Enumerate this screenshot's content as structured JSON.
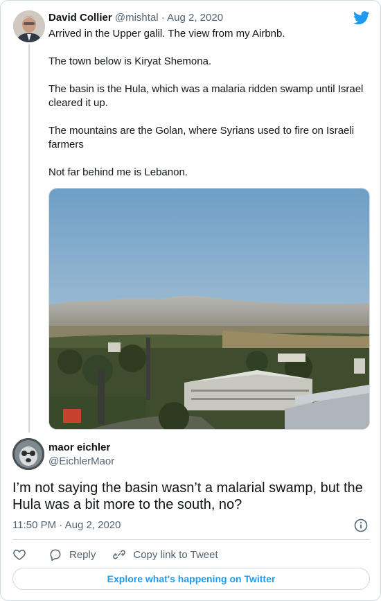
{
  "parent_tweet": {
    "author_name": "David Collier",
    "author_handle": "@mishtal",
    "date": "Aug 2, 2020",
    "separator": "·",
    "paragraphs": [
      "Arrived in the Upper galil. The view from my Airbnb.",
      "The town below is Kiryat Shemona.",
      "The basin is the Hula, which was a malaria ridden swamp until Israel cleared it up.",
      "The mountains are the Golan, where Syrians used to fire on Israeli farmers",
      "Not far behind me is Lebanon."
    ]
  },
  "main_tweet": {
    "author_name": "maor eichler",
    "author_handle": "@EichlerMaor",
    "text": "I’m not saying the basin wasn’t a malarial swamp, but the Hula was a bit more to the south, no?",
    "time": "11:50 PM",
    "date": "Aug 2, 2020",
    "meta": "11:50 PM · Aug 2, 2020"
  },
  "actions": {
    "reply_label": "Reply",
    "copy_link_label": "Copy link to Tweet"
  },
  "explore_label": "Explore what's happening on Twitter",
  "icons": {
    "brand": "twitter-bird-icon",
    "like": "heart-icon",
    "reply": "speech-bubble-icon",
    "copy": "link-icon",
    "info": "info-icon"
  },
  "colors": {
    "accent": "#1d9bf0",
    "text": "#0f1419",
    "secondary": "#536471",
    "border": "#cfd9de"
  }
}
